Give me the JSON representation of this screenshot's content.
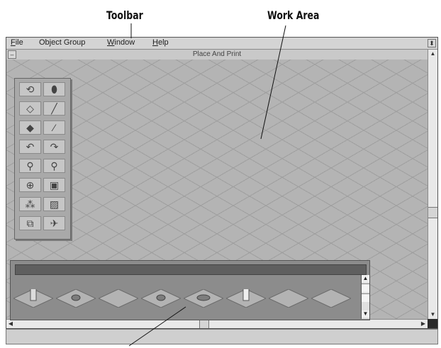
{
  "callouts": {
    "toolbar": "Toolbar",
    "work_area": "Work Area"
  },
  "menu": {
    "items": [
      {
        "name": "file",
        "mnemonic": "F",
        "rest": "ile"
      },
      {
        "name": "object-group",
        "mnemonic": "",
        "rest": "Object Group"
      },
      {
        "name": "window",
        "mnemonic": "W",
        "rest": "indow"
      },
      {
        "name": "help",
        "mnemonic": "H",
        "rest": "elp"
      }
    ],
    "control_box_glyph": "⬍"
  },
  "window": {
    "title": "Place And Print",
    "system_menu_glyph": "–"
  },
  "toolbox": {
    "tools": [
      {
        "name": "rotate-tool",
        "icon": "rotate-icon",
        "glyph": "⟲"
      },
      {
        "name": "drop-tool",
        "icon": "drop-icon",
        "glyph": "⬮"
      },
      {
        "name": "flat-tile-tool",
        "icon": "flat-tile-icon",
        "glyph": "◇"
      },
      {
        "name": "wall-tool",
        "icon": "wall-icon",
        "glyph": "╱"
      },
      {
        "name": "floor-tool",
        "icon": "floor-icon",
        "glyph": "◆"
      },
      {
        "name": "line-tool",
        "icon": "line-icon",
        "glyph": "⁄"
      },
      {
        "name": "undo-tool",
        "icon": "undo-icon",
        "glyph": "↶"
      },
      {
        "name": "redo-tool",
        "icon": "redo-icon",
        "glyph": "↷"
      },
      {
        "name": "zoom-in-tool",
        "icon": "zoom-in-icon",
        "glyph": "⚲"
      },
      {
        "name": "zoom-out-tool",
        "icon": "zoom-out-icon",
        "glyph": "⚲"
      },
      {
        "name": "globe-tool",
        "icon": "globe-icon",
        "glyph": "⊕"
      },
      {
        "name": "frame-tool",
        "icon": "frame-icon",
        "glyph": "▣"
      },
      {
        "name": "people-tool",
        "icon": "people-icon",
        "glyph": "⁂"
      },
      {
        "name": "grid-tool",
        "icon": "grid-icon",
        "glyph": "▨"
      },
      {
        "name": "objects-tool",
        "icon": "objects-icon",
        "glyph": "⧉"
      },
      {
        "name": "plane-tool",
        "icon": "plane-icon",
        "glyph": "✈"
      }
    ]
  },
  "tray": {
    "tiles": [
      {
        "name": "tile-statue",
        "icon": "statue-icon"
      },
      {
        "name": "tile-debris",
        "icon": "debris-icon"
      },
      {
        "name": "tile-plain",
        "icon": "plain-tile-icon"
      },
      {
        "name": "tile-small-object",
        "icon": "small-object-icon"
      },
      {
        "name": "tile-car",
        "icon": "car-icon"
      },
      {
        "name": "tile-tower",
        "icon": "tower-icon"
      },
      {
        "name": "tile-empty-1",
        "icon": "plain-tile-icon"
      },
      {
        "name": "tile-empty-2",
        "icon": "plain-tile-icon"
      }
    ],
    "scroll_up_glyph": "▲",
    "scroll_down_glyph": "▼"
  },
  "colors": {
    "work_area": "#b4b4b4",
    "grid_lines": "#9e9e9e",
    "tray": "#8c8c8c",
    "tray_header": "#5f5f5f"
  }
}
